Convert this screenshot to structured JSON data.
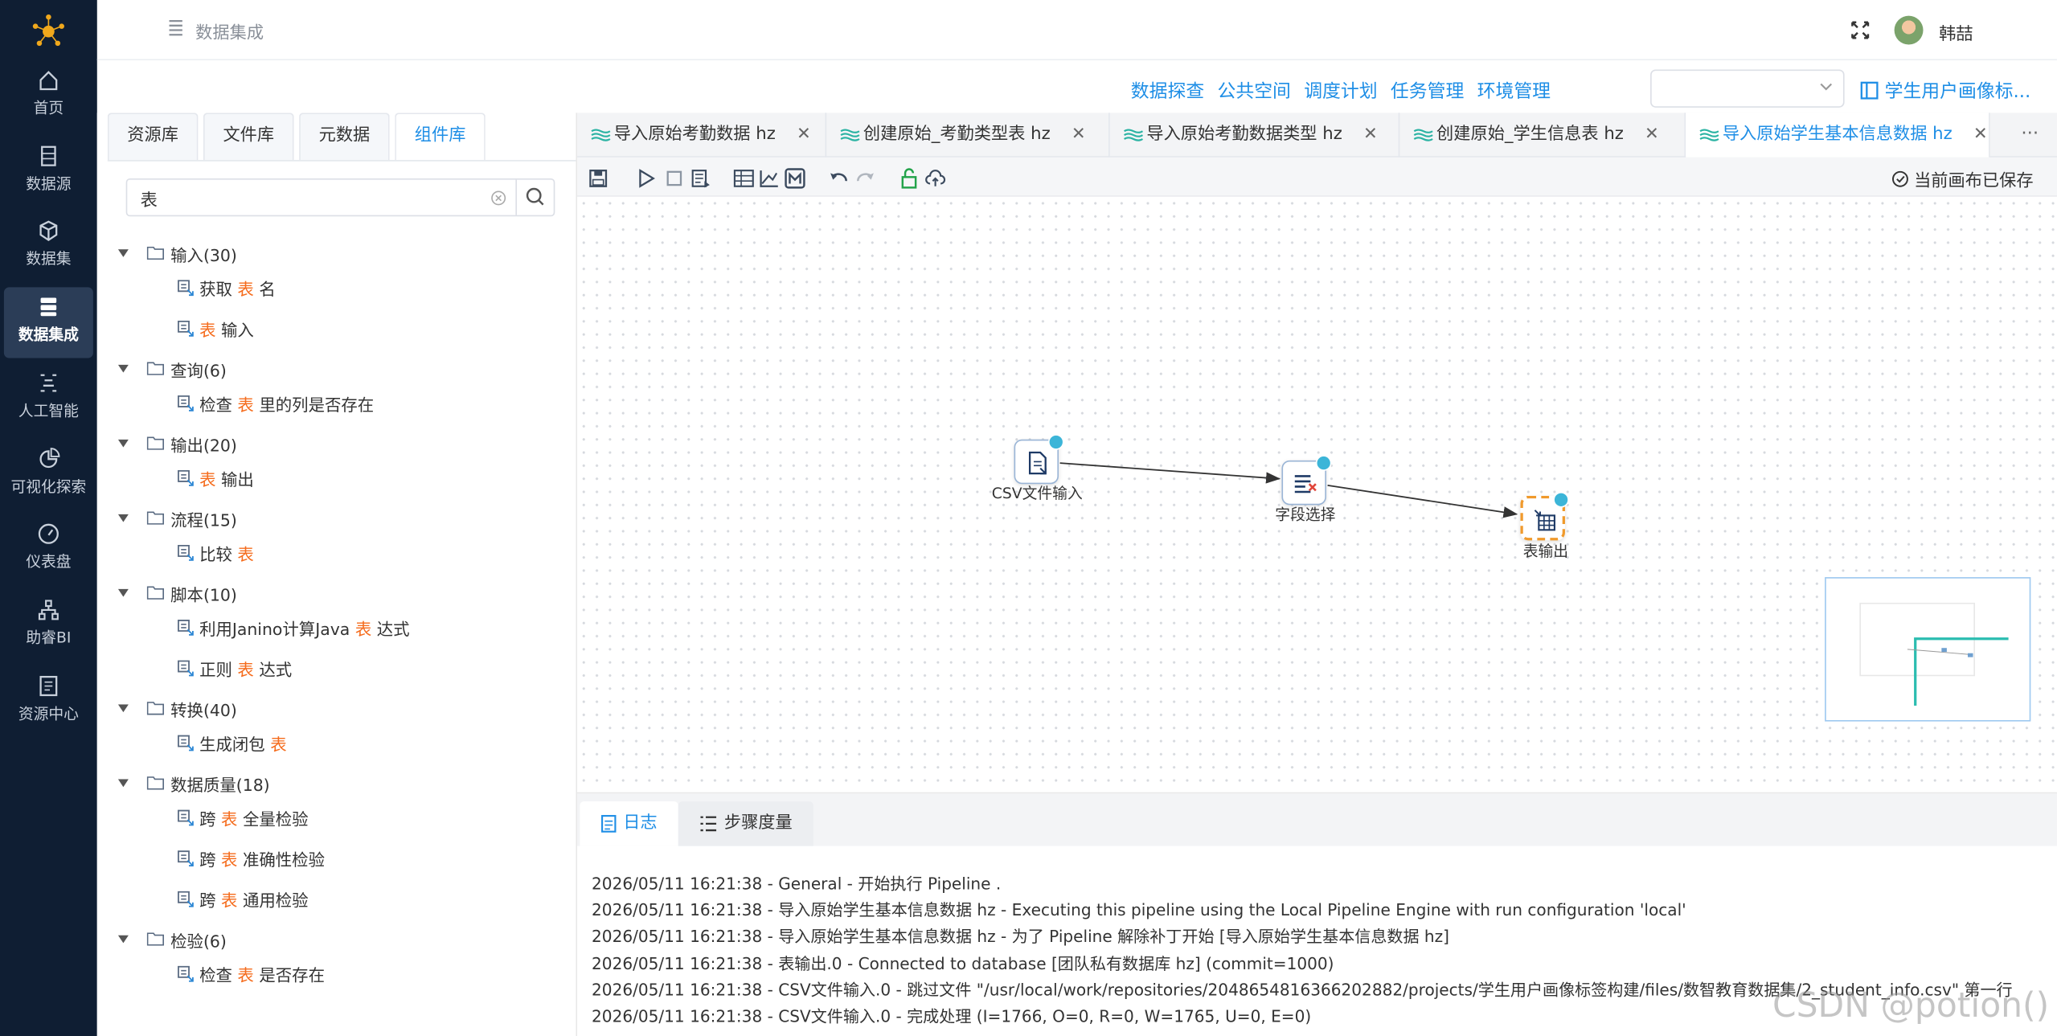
{
  "header": {
    "title": "数据集成",
    "username": "韩喆"
  },
  "nav": {
    "items": [
      {
        "label": "首页",
        "icon": "home-icon"
      },
      {
        "label": "数据源",
        "icon": "database-icon"
      },
      {
        "label": "数据集",
        "icon": "cube-icon"
      },
      {
        "label": "数据集成",
        "icon": "server-icon"
      },
      {
        "label": "人工智能",
        "icon": "ai-icon"
      },
      {
        "label": "可视化探索",
        "icon": "pie-chart-icon"
      },
      {
        "label": "仪表盘",
        "icon": "gauge-icon"
      },
      {
        "label": "助睿BI",
        "icon": "org-icon"
      },
      {
        "label": "资源中心",
        "icon": "document-icon"
      }
    ],
    "active": "数据集成"
  },
  "toolbar": {
    "links": [
      "数据探查",
      "公共空间",
      "调度计划",
      "任务管理",
      "环境管理"
    ],
    "select_value": "",
    "project": "学生用户画像标..."
  },
  "left_panel": {
    "tabs": [
      "资源库",
      "文件库",
      "元数据",
      "组件库"
    ],
    "active_tab": "组件库",
    "search_value": "表",
    "highlight": "表",
    "groups": [
      {
        "name": "输入(30)",
        "items": [
          {
            "pre": "获取",
            "post": "名"
          },
          {
            "pre": "",
            "post": "输入"
          }
        ]
      },
      {
        "name": "查询(6)",
        "items": [
          {
            "pre": "检查",
            "post": "里的列是否存在"
          }
        ]
      },
      {
        "name": "输出(20)",
        "items": [
          {
            "pre": "",
            "post": "输出"
          }
        ]
      },
      {
        "name": "流程(15)",
        "items": [
          {
            "pre": "比较",
            "post": ""
          }
        ]
      },
      {
        "name": "脚本(10)",
        "items": [
          {
            "pre": "利用Janino计算Java",
            "post": "达式"
          },
          {
            "pre": "正则",
            "post": "达式"
          }
        ]
      },
      {
        "name": "转换(40)",
        "items": [
          {
            "pre": "生成闭包",
            "post": ""
          }
        ]
      },
      {
        "name": "数据质量(18)",
        "items": [
          {
            "pre": "跨",
            "post": "全量检验"
          },
          {
            "pre": "跨",
            "post": "准确性检验"
          },
          {
            "pre": "跨",
            "post": "通用检验"
          }
        ]
      },
      {
        "name": "检验(6)",
        "items": [
          {
            "pre": "检查",
            "post": "是否存在"
          }
        ]
      }
    ]
  },
  "file_tabs": [
    {
      "label": "导入原始考勤数据 hz",
      "active": false
    },
    {
      "label": "创建原始_考勤类型表 hz",
      "active": false
    },
    {
      "label": "导入原始考勤数据类型 hz",
      "active": false
    },
    {
      "label": "创建原始_学生信息表 hz",
      "active": false
    },
    {
      "label": "导入原始学生基本信息数据 hz",
      "active": true
    }
  ],
  "more_label": "···",
  "close_label": "✕",
  "canvas": {
    "status": "当前画布已保存",
    "nodes": [
      {
        "label": "CSV文件输入",
        "icon": "csv-input-icon"
      },
      {
        "label": "字段选择",
        "icon": "field-select-icon"
      },
      {
        "label": "表输出",
        "icon": "table-output-icon"
      }
    ]
  },
  "bottom": {
    "tabs": [
      "日志",
      "步骤度量"
    ],
    "active_tab": "日志",
    "logs": [
      "2026/05/11 16:21:38 - General - 开始执行 Pipeline .",
      "2026/05/11 16:21:38 - 导入原始学生基本信息数据 hz - Executing this pipeline using the Local Pipeline Engine with run configuration 'local'",
      "2026/05/11 16:21:38 - 导入原始学生基本信息数据 hz - 为了 Pipeline 解除补丁开始 [导入原始学生基本信息数据 hz]",
      "2026/05/11 16:21:38 - 表输出.0 - Connected to database [团队私有数据库 hz] (commit=1000)",
      "2026/05/11 16:21:38 - CSV文件输入.0 - 跳过文件 \"/usr/local/work/repositories/2048654816366202882/projects/学生用户画像标签构建/files/数智教育数据集/2_student_info.csv\" 第一行",
      "2026/05/11 16:21:38 - CSV文件输入.0 - 完成处理 (I=1766, O=0, R=0, W=1765, U=0, E=0)"
    ]
  },
  "watermark": "CSDN @potion()",
  "colors": {
    "nav_bg": "#0f1e33",
    "accent": "#1e8ee6",
    "highlight": "#f56c1d"
  }
}
